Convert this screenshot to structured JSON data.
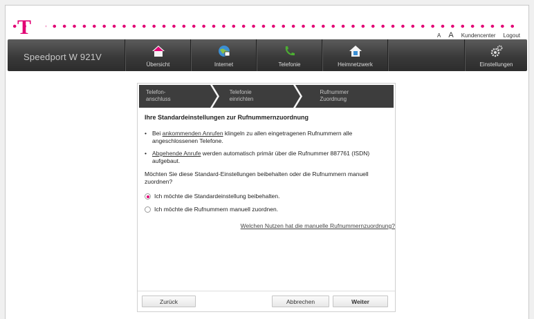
{
  "header": {
    "logo_letter": "T",
    "font_small": "A",
    "font_large": "A",
    "kundencenter": "Kundencenter",
    "logout": "Logout"
  },
  "nav": {
    "brand": "Speedport W 921V",
    "items": [
      {
        "label": "Übersicht",
        "icon": "home-icon"
      },
      {
        "label": "Internet",
        "icon": "globe-icon"
      },
      {
        "label": "Telefonie",
        "icon": "phone-icon"
      },
      {
        "label": "Heimnetzwerk",
        "icon": "house-network-icon"
      },
      {
        "label": "Einstellungen",
        "icon": "gear-icon"
      }
    ]
  },
  "steps": [
    {
      "line1": "Telefon-",
      "line2": "anschluss"
    },
    {
      "line1": "Telefonie",
      "line2": "einrichten"
    },
    {
      "line1": "Rufnummer",
      "line2": "Zuordnung"
    }
  ],
  "content": {
    "heading": "Ihre Standardeinstellungen zur Rufnummernzuordnung",
    "bullet1_pre": "Bei ",
    "bullet1_link": "ankommenden Anrufen",
    "bullet1_post": " klingeln zu allen eingetragenen Rufnummern alle angeschlossenen Telefone.",
    "bullet2_link": "Abgehende Anrufe",
    "bullet2_post": " werden automatisch primär über die Rufnummer 887761 (ISDN) aufgebaut.",
    "question": "Möchten Sie diese Standard-Einstellungen beibehalten oder die Rufnummern manuell zuordnen?",
    "option1": "Ich möchte die Standardeinstellung beibehalten.",
    "option2": "Ich möchte die Rufnummern manuell zuordnen.",
    "help_link": "Welchen Nutzen hat die manuelle Rufnummernzuordnung?"
  },
  "buttons": {
    "back": "Zurück",
    "cancel": "Abbrechen",
    "next": "Weiter"
  },
  "colors": {
    "brand_magenta": "#e20074",
    "navbar": "#3a3a3a"
  }
}
